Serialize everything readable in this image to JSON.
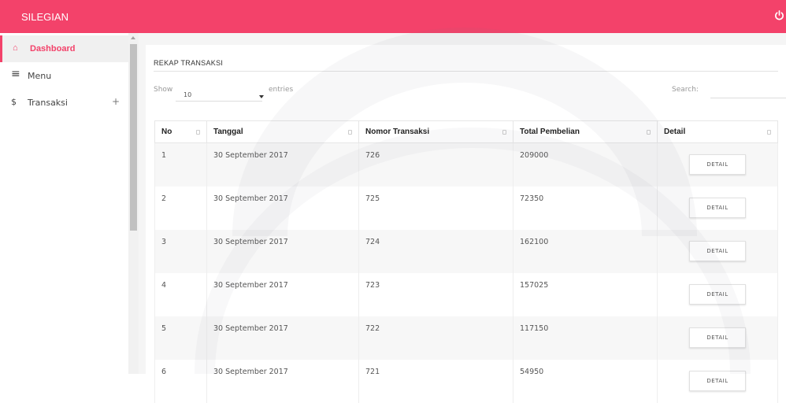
{
  "app": {
    "brand": "SILEGIAN"
  },
  "sidebar": {
    "items": [
      {
        "label": "Dashboard",
        "icon": "home-icon",
        "glyph": "⌂",
        "active": true
      },
      {
        "label": "Menu",
        "icon": "menu-icon",
        "glyph": "≡"
      },
      {
        "label": "Transaksi",
        "icon": "dollar-icon",
        "glyph": "$",
        "expand": "+"
      }
    ]
  },
  "card": {
    "title": "REKAP TRANSAKSI",
    "show_label": "Show",
    "page_length": "10",
    "entries_label": "entries",
    "search_label": "Search:",
    "search_value": ""
  },
  "table": {
    "columns": [
      "No",
      "Tanggal",
      "Nomor Transaksi",
      "Total Pembelian",
      "Detail"
    ],
    "detail_button_label": "DETAIL",
    "rows": [
      {
        "no": "1",
        "tanggal": "30 September 2017",
        "nomor": "726",
        "total": "209000"
      },
      {
        "no": "2",
        "tanggal": "30 September 2017",
        "nomor": "725",
        "total": "72350"
      },
      {
        "no": "3",
        "tanggal": "30 September 2017",
        "nomor": "724",
        "total": "162100"
      },
      {
        "no": "4",
        "tanggal": "30 September 2017",
        "nomor": "723",
        "total": "157025"
      },
      {
        "no": "5",
        "tanggal": "30 September 2017",
        "nomor": "722",
        "total": "117150"
      },
      {
        "no": "6",
        "tanggal": "30 September 2017",
        "nomor": "721",
        "total": "54950"
      }
    ]
  },
  "colors": {
    "accent": "#f3426a",
    "sidebar_active_bg": "#f0f0f0",
    "row_odd": "#f7f7f7"
  }
}
